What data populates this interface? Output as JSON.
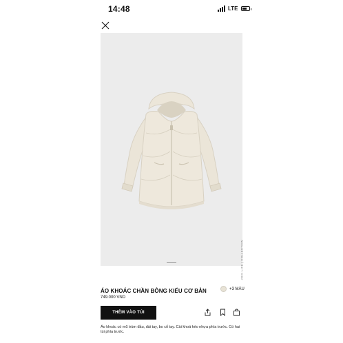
{
  "status_bar": {
    "time": "14:48",
    "network": "LTE",
    "battery_level": 0.7
  },
  "header": {
    "close_icon": "close-icon"
  },
  "gallery": {
    "collection_label": "JOIN LIFE | COLLECTION"
  },
  "product": {
    "title": "ÁO KHOÁC CHẦN BÔNG KIỂU CƠ BẢN",
    "price": "749.000 VND",
    "more_colors": "+3 MÀU",
    "swatch_color": "#e8e3d6",
    "add_to_bag_label": "THÊM VÀO TÚI",
    "description": "Áo khoác có mũ trùm đầu, dài tay, bo cổ tay. Cài khoá kéo nhựa phía trước. Có hai túi phía trước."
  },
  "actions": {
    "share_icon": "share-icon",
    "wishlist_icon": "bookmark-icon",
    "bag_icon": "shopping-bag-icon"
  }
}
